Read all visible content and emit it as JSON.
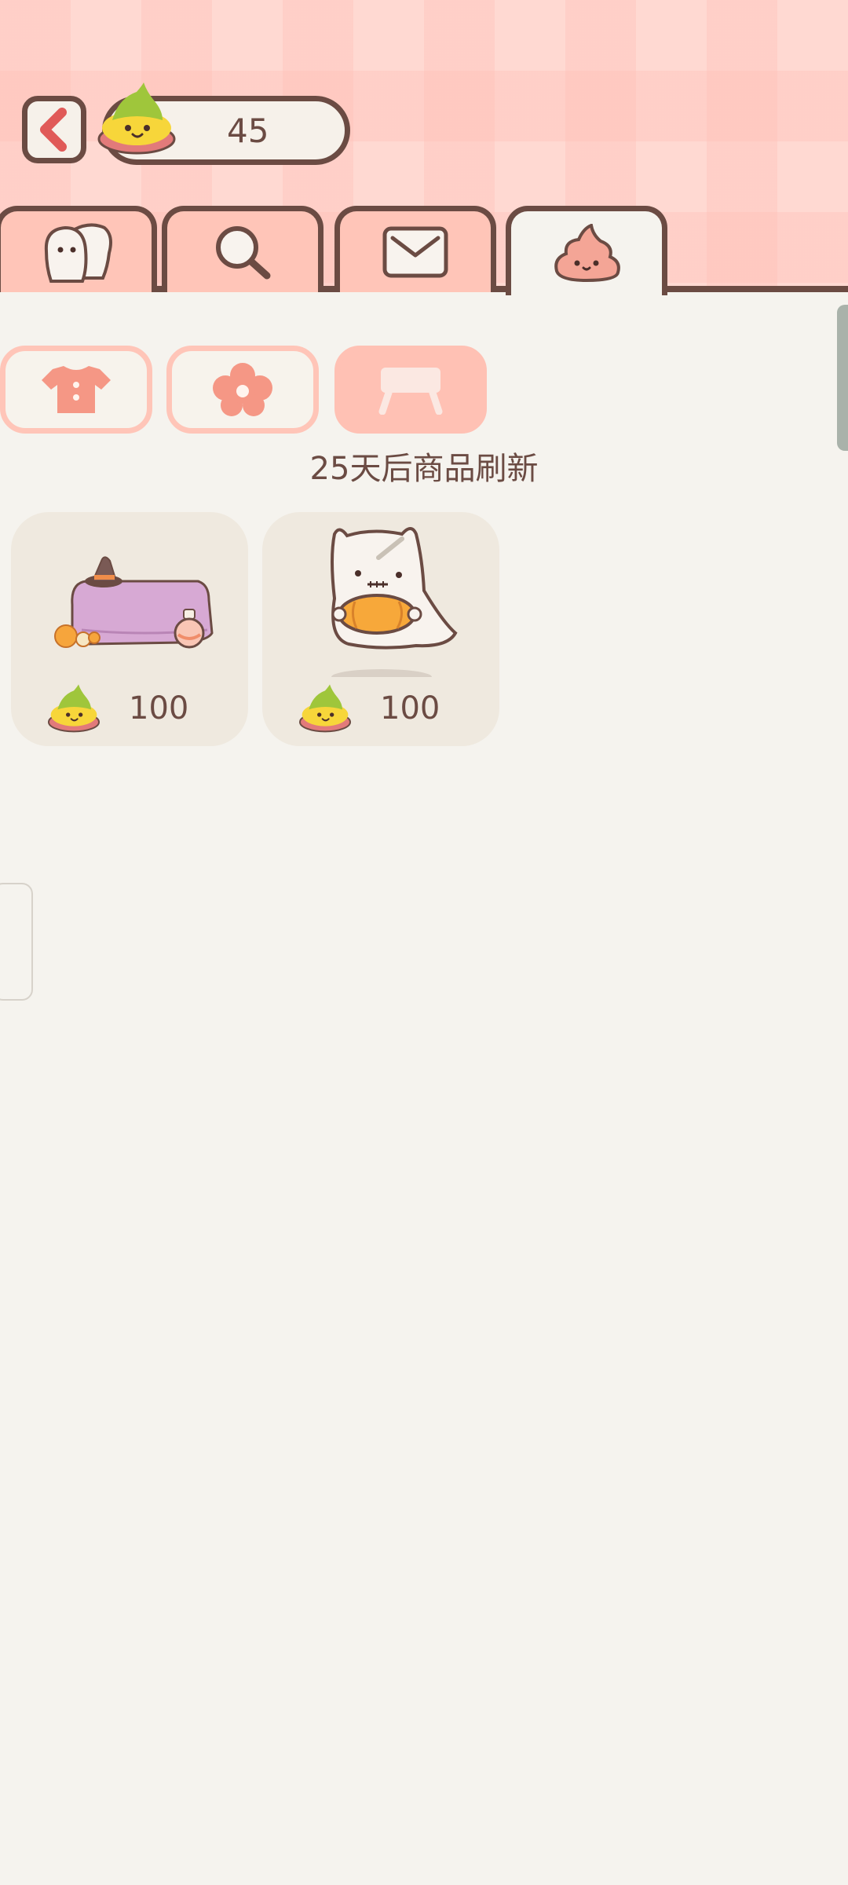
{
  "header": {
    "currency_icon": "rainbow-poop-coin-icon",
    "currency_amount": "45",
    "back_icon": "chevron-left-icon"
  },
  "tabs": [
    {
      "name": "friends",
      "icon": "ghost-friends-icon"
    },
    {
      "name": "search",
      "icon": "magnifier-icon"
    },
    {
      "name": "mail",
      "icon": "envelope-icon"
    },
    {
      "name": "shop",
      "icon": "pink-poop-icon",
      "active": true
    }
  ],
  "categories": [
    {
      "name": "clothes",
      "icon": "shirt-icon"
    },
    {
      "name": "flower",
      "icon": "flower-icon"
    },
    {
      "name": "furniture",
      "icon": "table-icon",
      "active": true
    }
  ],
  "refresh_text": "25天后商品刷新",
  "items": [
    {
      "name": "halloween-table",
      "icon": "purple-table-with-witch-hat-icon",
      "price": "100"
    },
    {
      "name": "ghost-cat-with-pumpkin",
      "icon": "ghost-cat-pumpkin-icon",
      "price": "100"
    }
  ],
  "colors": {
    "accent": "#ffc5b8",
    "outline": "#6b4b43",
    "background": "#f5f3ee"
  }
}
